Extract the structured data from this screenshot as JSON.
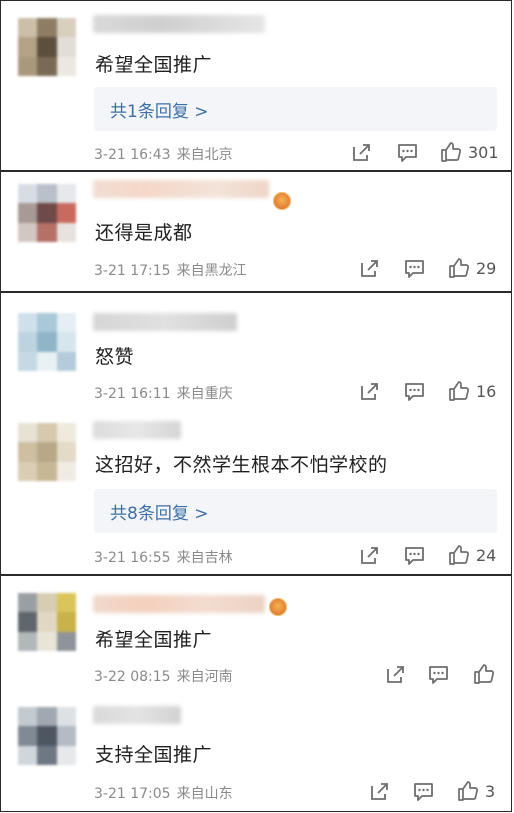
{
  "comments": [
    {
      "text": "希望全国推广",
      "reply": "共1条回复 >",
      "date": "3-21 16:43",
      "location": "来自北京",
      "likes": "301",
      "badge": false,
      "avatar_colors": [
        "#cbbfa8",
        "#8e7d64",
        "#d8cfbf",
        "#b5a287",
        "#5d4f3e",
        "#e2ddd5",
        "#a9987c",
        "#7a6a54",
        "#ece8e1"
      ]
    },
    {
      "text": "还得是成都",
      "date": "3-21 17:15",
      "location": "来自黑龙江",
      "likes": "29",
      "badge": true,
      "avatar_colors": [
        "#d8dde4",
        "#b9c0c9",
        "#e6e8ec",
        "#a79a96",
        "#6e4a4a",
        "#c96a5f",
        "#d2c7c3",
        "#b57068",
        "#e8e2df"
      ]
    },
    {
      "text": "怒赞",
      "date": "3-21 16:11",
      "location": "来自重庆",
      "likes": "16",
      "badge": false,
      "avatar_colors": [
        "#cfe0ea",
        "#a9c8d8",
        "#e4eef3",
        "#bcd4df",
        "#8fb6c8",
        "#d6e6ed",
        "#c4d9e3",
        "#e9f1f4",
        "#b2ccd9"
      ]
    },
    {
      "text": "这招好，不然学生根本不怕学校的",
      "reply": "共8条回复 >",
      "date": "3-21 16:55",
      "location": "来自吉林",
      "likes": "24",
      "badge": false,
      "avatar_colors": [
        "#e8e2d4",
        "#d6c9ad",
        "#efe9de",
        "#cdbfa0",
        "#b9a887",
        "#e3dac8",
        "#d9cdb4",
        "#c7b794",
        "#f1ece3"
      ]
    },
    {
      "text": "希望全国推广",
      "date": "3-22 08:15",
      "location": "来自河南",
      "likes": "",
      "badge": true,
      "avatar_colors": [
        "#9a9fa3",
        "#d6cdb3",
        "#d9c55a",
        "#5f666c",
        "#e0d8c4",
        "#c9b24a",
        "#b2b7b9",
        "#e9e4d8",
        "#8f949a"
      ]
    },
    {
      "text": "支持全国推广",
      "date": "3-21 17:05",
      "location": "来自山东",
      "likes": "3",
      "badge": false,
      "avatar_colors": [
        "#c3cad0",
        "#a0a9b1",
        "#dde1e4",
        "#7f8a94",
        "#4e5761",
        "#b3bcc3",
        "#d1d6da",
        "#6d7884",
        "#e6e8ea"
      ]
    }
  ]
}
